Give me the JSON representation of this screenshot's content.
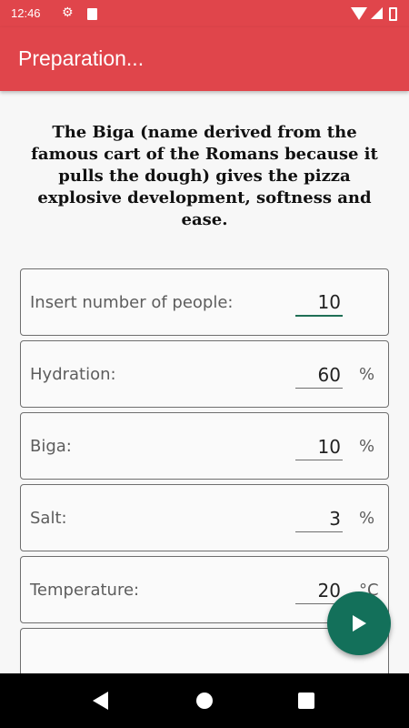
{
  "status_bar": {
    "time": "12:46",
    "icons": [
      "gear-icon",
      "sd-card-icon",
      "wifi-icon",
      "signal-icon",
      "battery-icon"
    ]
  },
  "app_bar": {
    "title": "Preparation..."
  },
  "intro_text": "The Biga (name derived from the famous cart of the Romans because it pulls the dough) gives the pizza explosive development, softness and ease.",
  "fields": [
    {
      "label": "Insert number of people:",
      "value": "10",
      "unit": ""
    },
    {
      "label": "Hydration:",
      "value": "60",
      "unit": "%"
    },
    {
      "label": "Biga:",
      "value": "10",
      "unit": "%"
    },
    {
      "label": "Salt:",
      "value": "3",
      "unit": "%"
    },
    {
      "label": "Temperature:",
      "value": "20",
      "unit": "°C"
    }
  ],
  "fab": {
    "icon": "play-icon"
  },
  "nav_bar": {
    "icons": [
      "back-icon",
      "home-icon",
      "recents-icon"
    ]
  },
  "colors": {
    "primary": "#e0454b",
    "accent": "#13705a"
  }
}
